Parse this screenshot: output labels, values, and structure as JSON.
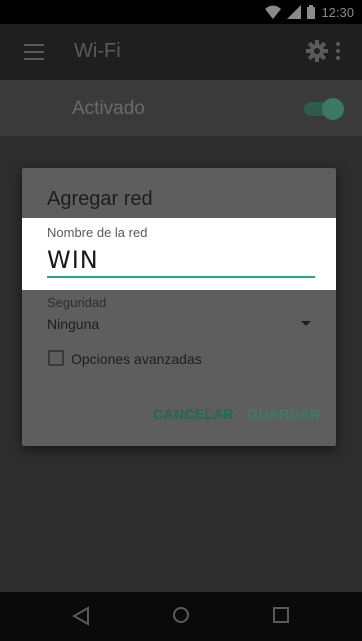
{
  "status_bar": {
    "time": "12:30"
  },
  "app_bar": {
    "title": "Wi-Fi"
  },
  "wifi_switch": {
    "label": "Activado",
    "on": true
  },
  "dialog": {
    "title": "Agregar red",
    "network_name": {
      "label": "Nombre de la red",
      "value": "WIN"
    },
    "security": {
      "label": "Seguridad",
      "value": "Ninguna"
    },
    "advanced_options": {
      "label": "Opciones avanzadas",
      "checked": false
    },
    "buttons": {
      "cancel": "CANCELAR",
      "save": "GUARDAR"
    }
  },
  "colors": {
    "accent": "#26a98a",
    "button_text": "#1d6a55"
  }
}
